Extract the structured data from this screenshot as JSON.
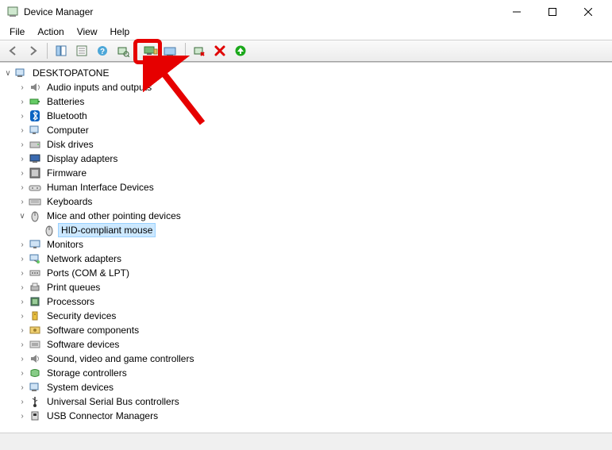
{
  "window": {
    "title": "Device Manager"
  },
  "menu": {
    "file": "File",
    "action": "Action",
    "view": "View",
    "help": "Help"
  },
  "tree": {
    "root": "DESKTOPATONE",
    "nodes": [
      {
        "label": "Audio inputs and outputs",
        "icon": "speaker",
        "expanded": false,
        "children": []
      },
      {
        "label": "Batteries",
        "icon": "battery",
        "expanded": false,
        "children": []
      },
      {
        "label": "Bluetooth",
        "icon": "bluetooth",
        "expanded": false,
        "children": []
      },
      {
        "label": "Computer",
        "icon": "computer",
        "expanded": false,
        "children": []
      },
      {
        "label": "Disk drives",
        "icon": "disk",
        "expanded": false,
        "children": []
      },
      {
        "label": "Display adapters",
        "icon": "display",
        "expanded": false,
        "children": []
      },
      {
        "label": "Firmware",
        "icon": "firmware",
        "expanded": false,
        "children": []
      },
      {
        "label": "Human Interface Devices",
        "icon": "hid",
        "expanded": false,
        "children": []
      },
      {
        "label": "Keyboards",
        "icon": "keyboard",
        "expanded": false,
        "children": []
      },
      {
        "label": "Mice and other pointing devices",
        "icon": "mouse",
        "expanded": true,
        "children": [
          {
            "label": "HID-compliant mouse",
            "icon": "mouse",
            "selected": true
          }
        ]
      },
      {
        "label": "Monitors",
        "icon": "monitor",
        "expanded": false,
        "children": []
      },
      {
        "label": "Network adapters",
        "icon": "network",
        "expanded": false,
        "children": []
      },
      {
        "label": "Ports (COM & LPT)",
        "icon": "port",
        "expanded": false,
        "children": []
      },
      {
        "label": "Print queues",
        "icon": "printer",
        "expanded": false,
        "children": []
      },
      {
        "label": "Processors",
        "icon": "cpu",
        "expanded": false,
        "children": []
      },
      {
        "label": "Security devices",
        "icon": "security",
        "expanded": false,
        "children": []
      },
      {
        "label": "Software components",
        "icon": "swcomp",
        "expanded": false,
        "children": []
      },
      {
        "label": "Software devices",
        "icon": "swdev",
        "expanded": false,
        "children": []
      },
      {
        "label": "Sound, video and game controllers",
        "icon": "sound",
        "expanded": false,
        "children": []
      },
      {
        "label": "Storage controllers",
        "icon": "storage",
        "expanded": false,
        "children": []
      },
      {
        "label": "System devices",
        "icon": "system",
        "expanded": false,
        "children": []
      },
      {
        "label": "Universal Serial Bus controllers",
        "icon": "usb",
        "expanded": false,
        "children": []
      },
      {
        "label": "USB Connector Managers",
        "icon": "usbconn",
        "expanded": false,
        "children": []
      }
    ]
  }
}
